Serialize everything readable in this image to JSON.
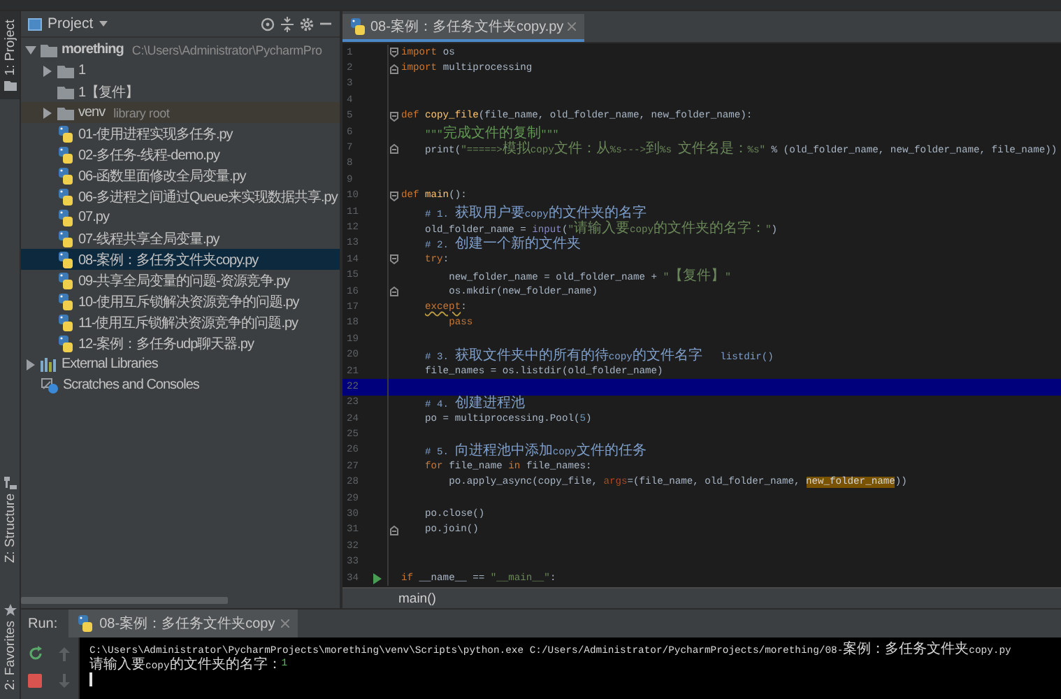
{
  "side_tabs": [
    {
      "kind": "project",
      "label": "1: Project",
      "selected": true
    },
    {
      "kind": "structure",
      "label": "Z: Structure",
      "selected": false
    },
    {
      "kind": "favorites",
      "label": "2: Favorites",
      "selected": false
    }
  ],
  "project_panel": {
    "title": "Project",
    "tree": [
      {
        "kind": "folder",
        "name": "morething",
        "note": "C:\\Users\\Administrator\\PycharmPro",
        "expanded": true,
        "selected": false,
        "excluded": false,
        "children": [
          {
            "kind": "folder",
            "name": "1",
            "expanded": false,
            "selected": false,
            "excluded": false
          },
          {
            "kind": "folder",
            "name": "1【复件】",
            "selected": false,
            "excluded": false
          },
          {
            "kind": "folder",
            "name": "venv",
            "note": "library root",
            "expanded": false,
            "selected": false,
            "excluded": true
          },
          {
            "kind": "python",
            "name": "01-使用进程实现多任务.py",
            "selected": false,
            "excluded": false
          },
          {
            "kind": "python",
            "name": "02-多任务-线程-demo.py",
            "selected": false,
            "excluded": false
          },
          {
            "kind": "python",
            "name": "06-函数里面修改全局变量.py",
            "selected": false,
            "excluded": false
          },
          {
            "kind": "python",
            "name": "06-多进程之间通过Queue来实现数据共享.py",
            "selected": false,
            "excluded": false
          },
          {
            "kind": "python",
            "name": "07.py",
            "selected": false,
            "excluded": false
          },
          {
            "kind": "python",
            "name": "07-线程共享全局变量.py",
            "selected": false,
            "excluded": false
          },
          {
            "kind": "python",
            "name": "08-案例：多任务文件夹copy.py",
            "selected": true,
            "excluded": false
          },
          {
            "kind": "python",
            "name": "09-共享全局变量的问题-资源竞争.py",
            "selected": false,
            "excluded": false
          },
          {
            "kind": "python",
            "name": "10-使用互斥锁解决资源竞争的问题.py",
            "selected": false,
            "excluded": false
          },
          {
            "kind": "python",
            "name": "11-使用互斥锁解决资源竞争的问题.py",
            "selected": false,
            "excluded": false
          },
          {
            "kind": "python",
            "name": "12-案例：多任务udp聊天器.py",
            "selected": false,
            "excluded": false
          }
        ]
      },
      {
        "kind": "library",
        "name": "External Libraries",
        "expanded": false,
        "selected": false,
        "excluded": false
      },
      {
        "kind": "scratches",
        "name": "Scratches and Consoles",
        "selected": false,
        "excluded": false
      }
    ]
  },
  "editor": {
    "tab": {
      "label": "08-案例：多任务文件夹copy.py",
      "selected": true
    },
    "lines": [
      {
        "number": "1",
        "current": false,
        "fold_start": true,
        "tokens": [
          {
            "kind": "keyword",
            "text": "import"
          },
          {
            "kind": "plain",
            "text": " os"
          }
        ]
      },
      {
        "number": "2",
        "current": false,
        "fold_end": true,
        "tokens": [
          {
            "kind": "keyword",
            "text": "import"
          },
          {
            "kind": "plain",
            "text": " multiprocessing"
          }
        ]
      },
      {
        "number": "3",
        "current": false
      },
      {
        "number": "4",
        "current": false
      },
      {
        "number": "5",
        "current": false,
        "fold_start": true,
        "tokens": [
          {
            "kind": "keyword",
            "text": "def "
          },
          {
            "kind": "function",
            "text": "copy_file"
          },
          {
            "kind": "plain",
            "text": "(file_name, old_folder_name, new_folder_name):"
          }
        ]
      },
      {
        "number": "6",
        "current": false,
        "tokens": [
          {
            "kind": "docstring",
            "text": "    \"\"\"完成文件的复制\"\"\""
          }
        ]
      },
      {
        "number": "7",
        "current": false,
        "fold_end": true,
        "tokens": [
          {
            "kind": "plain",
            "text": "    print("
          },
          {
            "kind": "string",
            "text": "\"=====>模拟copy文件：从%s--->到%s 文件名是：%s\""
          },
          {
            "kind": "plain",
            "text": " % (old_folder_name, new_folder_name, file_name))"
          }
        ]
      },
      {
        "number": "8",
        "current": false
      },
      {
        "number": "9",
        "current": false
      },
      {
        "number": "10",
        "current": false,
        "fold_start": true,
        "tokens": [
          {
            "kind": "keyword",
            "text": "def "
          },
          {
            "kind": "function",
            "text": "main"
          },
          {
            "kind": "plain",
            "text": "():"
          }
        ]
      },
      {
        "number": "11",
        "current": false,
        "tokens": [
          {
            "kind": "comment",
            "text": "    # 1. 获取用户要copy的文件夹的名字"
          }
        ]
      },
      {
        "number": "12",
        "current": false,
        "tokens": [
          {
            "kind": "plain",
            "text": "    old_folder_name = "
          },
          {
            "kind": "builtin",
            "text": "input"
          },
          {
            "kind": "plain",
            "text": "("
          },
          {
            "kind": "string",
            "text": "\"请输入要copy的文件夹的名字：\""
          },
          {
            "kind": "plain",
            "text": ")"
          }
        ]
      },
      {
        "number": "13",
        "current": false,
        "tokens": [
          {
            "kind": "comment",
            "text": "    # 2. 创建一个新的文件夹"
          }
        ]
      },
      {
        "number": "14",
        "current": false,
        "fold_start": true,
        "tokens": [
          {
            "kind": "keyword",
            "text": "    try"
          },
          {
            "kind": "plain",
            "text": ":"
          }
        ]
      },
      {
        "number": "15",
        "current": false,
        "tokens": [
          {
            "kind": "plain",
            "text": "        new_folder_name = old_folder_name + "
          },
          {
            "kind": "string",
            "text": "\"【复件】\""
          }
        ]
      },
      {
        "number": "16",
        "current": false,
        "fold_end": true,
        "tokens": [
          {
            "kind": "plain",
            "text": "        os.mkdir(new_folder_name)"
          }
        ]
      },
      {
        "number": "17",
        "current": false,
        "tokens": [
          {
            "kind": "warning",
            "text": "    except"
          },
          {
            "kind": "plain",
            "text": ":"
          }
        ]
      },
      {
        "number": "18",
        "current": false,
        "tokens": [
          {
            "kind": "keyword",
            "text": "        pass"
          }
        ]
      },
      {
        "number": "19",
        "current": false
      },
      {
        "number": "20",
        "current": false,
        "tokens": [
          {
            "kind": "comment",
            "text": "    # 3. 获取文件夹中的所有的待copy的文件名字   listdir()"
          }
        ]
      },
      {
        "number": "21",
        "current": false,
        "tokens": [
          {
            "kind": "plain",
            "text": "    file_names = os.listdir(old_folder_name)"
          }
        ]
      },
      {
        "number": "22",
        "current": true
      },
      {
        "number": "23",
        "current": false,
        "tokens": [
          {
            "kind": "comment",
            "text": "    # 4. 创建进程池"
          }
        ]
      },
      {
        "number": "24",
        "current": false,
        "tokens": [
          {
            "kind": "plain",
            "text": "    po = multiprocessing.Pool("
          },
          {
            "kind": "number",
            "text": "5"
          },
          {
            "kind": "plain",
            "text": ")"
          }
        ]
      },
      {
        "number": "25",
        "current": false
      },
      {
        "number": "26",
        "current": false,
        "tokens": [
          {
            "kind": "comment",
            "text": "    # 5. 向进程池中添加copy文件的任务"
          }
        ]
      },
      {
        "number": "27",
        "current": false,
        "tokens": [
          {
            "kind": "keyword",
            "text": "    for"
          },
          {
            "kind": "plain",
            "text": " file_name "
          },
          {
            "kind": "keyword",
            "text": "in"
          },
          {
            "kind": "plain",
            "text": " file_names:"
          }
        ]
      },
      {
        "number": "28",
        "current": false,
        "tokens": [
          {
            "kind": "plain",
            "text": "        po.apply_async(copy_file, "
          },
          {
            "kind": "parameter",
            "text": "args"
          },
          {
            "kind": "plain",
            "text": "=(file_name, old_folder_name, "
          },
          {
            "kind": "match",
            "text": "new_folder_name"
          },
          {
            "kind": "plain",
            "text": "))"
          }
        ]
      },
      {
        "number": "29",
        "current": false
      },
      {
        "number": "30",
        "current": false,
        "tokens": [
          {
            "kind": "plain",
            "text": "    po.close()"
          }
        ]
      },
      {
        "number": "31",
        "current": false,
        "fold_end": true,
        "tokens": [
          {
            "kind": "plain",
            "text": "    po.join()"
          }
        ]
      },
      {
        "number": "32",
        "current": false
      },
      {
        "number": "33",
        "current": false
      },
      {
        "number": "34",
        "current": false,
        "run": true,
        "tokens": [
          {
            "kind": "keyword",
            "text": "if"
          },
          {
            "kind": "plain",
            "text": " __name__ == "
          },
          {
            "kind": "string",
            "text": "\"__main__\""
          },
          {
            "kind": "plain",
            "text": ":"
          }
        ]
      }
    ],
    "breadcrumb": "main()"
  },
  "run_panel": {
    "label": "Run:",
    "tab": {
      "label": "08-案例：多任务文件夹copy",
      "selected": true
    },
    "console": [
      {
        "kind": "command",
        "text": "C:\\Users\\Administrator\\PycharmProjects\\morething\\venv\\Scripts\\python.exe C:/Users/Administrator/PycharmProjects/morething/08-案例：多任务文件夹copy.py"
      },
      {
        "kind": "prompt",
        "text": "请输入要copy的文件夹的名字：",
        "input": "1"
      }
    ]
  }
}
